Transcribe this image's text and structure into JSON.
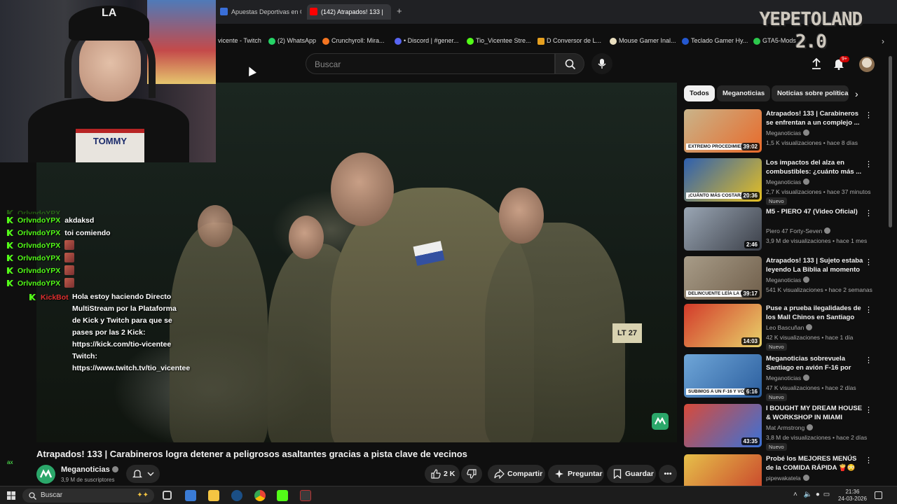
{
  "browser": {
    "tabs": [
      {
        "label": "Apuestas Deportivas en C",
        "color": "#3a6fd8"
      },
      {
        "label": "(142) Atrapados! 133 |",
        "color": "#ff0000"
      }
    ],
    "bookmarks": [
      {
        "label": "vicente - Twitch",
        "color": "#9146ff"
      },
      {
        "label": "(2) WhatsApp",
        "color": "#25d366"
      },
      {
        "label": "Crunchyroll: Mira...",
        "color": "#f47521"
      },
      {
        "label": "• Discord | #gener...",
        "color": "#5865f2"
      },
      {
        "label": "Tio_Vicentee Stre...",
        "color": "#53fc18"
      },
      {
        "label": "D Conversor de L...",
        "color": "#e6a020"
      },
      {
        "label": "Mouse Gamer Inal...",
        "color": "#eadfbf"
      },
      {
        "label": "Teclado Gamer Hy...",
        "color": "#2458d0"
      },
      {
        "label": "GTA5-Mods",
        "color": "#2cc84c"
      }
    ]
  },
  "overlay_logo": {
    "line1": "YEPETOLAND",
    "line2": "2.0"
  },
  "webcam": {
    "cap_logo": "LA",
    "shirt_text": "TOMMY"
  },
  "header": {
    "search_placeholder": "Buscar",
    "notif_count": "9+"
  },
  "chat": {
    "messages": [
      {
        "user": "OrlvndoYPX",
        "text": "akdaksd",
        "emote": false
      },
      {
        "user": "OrlvndoYPX",
        "text": "toi comiendo",
        "emote": false
      },
      {
        "user": "OrlvndoYPX",
        "text": "",
        "emote": true
      },
      {
        "user": "OrlvndoYPX",
        "text": "",
        "emote": true
      },
      {
        "user": "OrlvndoYPX",
        "text": "",
        "emote": true
      },
      {
        "user": "OrlvndoYPX",
        "text": "",
        "emote": true
      }
    ],
    "bot": {
      "name": "KickBot",
      "text": "Hola estoy haciendo Directo MultiStream por la Plataforma de Kick y Twitch para que se pases por las 2 Kick: https://kick.com/tio-vicentee Twitch: https://www.twitch.tv/tio_vicentee"
    },
    "side_label": "ax"
  },
  "video": {
    "title": "Atrapados! 133 | Carabineros logra detener a peligrosos asaltantes gracias a pista clave de vecinos",
    "channel": "Meganoticias",
    "subscribers": "3,9 M de suscriptores",
    "likes": "2 K",
    "share_label": "Compartir",
    "ask_label": "Preguntar",
    "save_label": "Guardar",
    "plate_text": "LT 27"
  },
  "chips": [
    "Todos",
    "Meganoticias",
    "Noticias sobre política"
  ],
  "recommendations": [
    {
      "title": "Atrapados! 133 | Carabineros se enfrentan a un complejo ...",
      "channel": "Meganoticias",
      "meta": "1,5 K visualizaciones • hace 8 días",
      "duration": "39:02",
      "caption": "EXTREMO PROCEDIMIENTO DE CARABINEROS",
      "badge_new": "",
      "colors": [
        "#c9b48a",
        "#e86a2a"
      ]
    },
    {
      "title": "Los impactos del alza en combustibles: ¿cuánto más ...",
      "channel": "Meganoticias",
      "meta": "2,7 K visualizaciones • hace 37 minutos",
      "duration": "20:36",
      "caption": "¡CUÁNTO MÁS COSTARÁ LLENAR EL ESTANQUE?",
      "badge_new": "Nuevo",
      "colors": [
        "#2d5fb0",
        "#e6c022"
      ]
    },
    {
      "title": "M5 - PIERO 47 (Video Oficial)",
      "channel": "Piero 47 Forty-Seven",
      "meta": "3,9 M de visualizaciones • hace 1 mes",
      "duration": "2:46",
      "caption": "",
      "badge_new": "",
      "colors": [
        "#9aa6b4",
        "#3b3f48"
      ]
    },
    {
      "title": "Atrapados! 133 | Sujeto estaba leyendo La Biblia al momento ...",
      "channel": "Meganoticias",
      "meta": "541 K visualizaciones • hace 2 semanas",
      "duration": "39:17",
      "caption": "DELINCUENTE LEÍA LA BIBLIA EN DETENCIÓN",
      "badge_new": "",
      "colors": [
        "#a89c88",
        "#6f5e4a"
      ]
    },
    {
      "title": "Puse a prueba ilegalidades de los Mall Chinos en Santiago",
      "channel": "Leo Bascuñan",
      "meta": "42 K visualizaciones • hace 1 día",
      "duration": "14:03",
      "caption": "",
      "badge_new": "Nuevo",
      "colors": [
        "#d33a2a",
        "#e8d26a"
      ]
    },
    {
      "title": "Meganoticias sobrevuela Santiago en avión F-16 por los...",
      "channel": "Meganoticias",
      "meta": "47 K visualizaciones • hace 2 días",
      "duration": "6:16",
      "caption": "SUBIMOS A UN F-16 Y VOLAMOS POR SANTIAGO",
      "badge_new": "Nuevo",
      "colors": [
        "#6fa6d8",
        "#2b5e9e"
      ]
    },
    {
      "title": "I BOUGHT MY DREAM HOUSE & WORKSHOP IN MIAMI",
      "channel": "Mat Armstrong",
      "meta": "3,8 M de visualizaciones • hace 2 días",
      "duration": "43:35",
      "caption": "",
      "badge_new": "Nuevo",
      "colors": [
        "#d84a3a",
        "#3a72d8"
      ]
    },
    {
      "title": "Probé los MEJORES MENÚS de la COMIDA RÁPIDA 🍟😳",
      "channel": "pipewakatela",
      "meta": "",
      "duration": "",
      "caption": "",
      "badge_new": "",
      "colors": [
        "#e6c04a",
        "#c8402a"
      ]
    }
  ],
  "taskbar": {
    "search_label": "Buscar",
    "time": "21:36",
    "date": "24-03-2026"
  }
}
